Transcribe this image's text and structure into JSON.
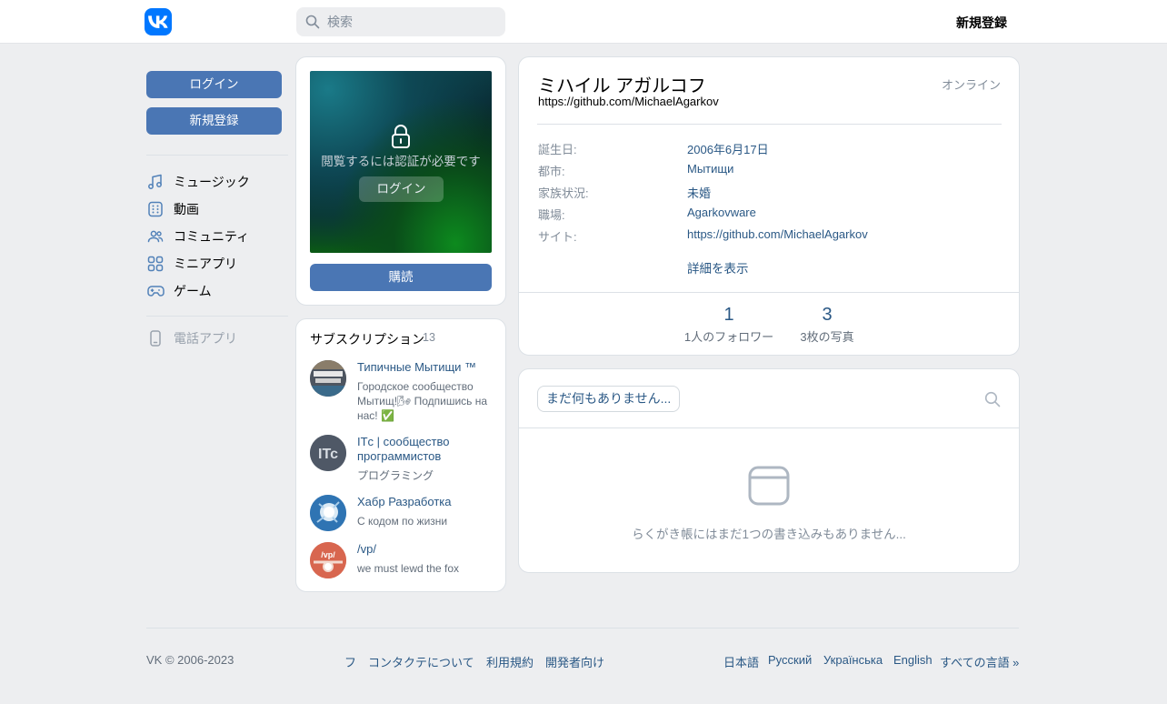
{
  "header": {
    "search_placeholder": "検索",
    "signup": "新規登録"
  },
  "sidebar": {
    "login": "ログイン",
    "signup": "新規登録",
    "items": [
      {
        "label": "ミュージック",
        "icon": "music-icon"
      },
      {
        "label": "動画",
        "icon": "video-icon"
      },
      {
        "label": "コミュニティ",
        "icon": "community-icon"
      },
      {
        "label": "ミニアプリ",
        "icon": "mini-apps-icon"
      },
      {
        "label": "ゲーム",
        "icon": "gamepad-icon"
      }
    ],
    "phone_app": "電話アプリ"
  },
  "photo_card": {
    "lock_text": "閲覧するには認証が必要です",
    "login": "ログイン",
    "subscribe": "購読"
  },
  "subscriptions": {
    "title": "サブスクリプション",
    "count": "13",
    "items": [
      {
        "name": "Типичные Мытищи ™",
        "desc": "Городское сообщество Мытищ!🌬 Подпишись на нас! ✅"
      },
      {
        "name": "ITс | сообщество программистов",
        "desc": "プログラミング"
      },
      {
        "name": "Хабр Разработка",
        "desc": "С кодом по жизни"
      },
      {
        "name": "/vp/",
        "desc": "we must lewd the fox"
      }
    ]
  },
  "profile": {
    "name": "ミハイル アガルコフ",
    "status": "https://github.com/MichaelAgarkov",
    "online": "オンライン",
    "info": [
      {
        "key": "誕生日:",
        "value": "2006年6月17日"
      },
      {
        "key": "都市:",
        "value": "Мытищи"
      },
      {
        "key": "家族状況:",
        "value": "未婚"
      },
      {
        "key": "職場:",
        "value": "Agarkovware"
      },
      {
        "key": "サイト:",
        "value": "https://github.com/MichaelAgarkov"
      }
    ],
    "more": "詳細を表示",
    "counters": [
      {
        "number": "1",
        "label": "1人のフォロワー"
      },
      {
        "number": "3",
        "label": "3枚の写真"
      }
    ]
  },
  "wall": {
    "tab": "まだ何もありません...",
    "empty_text": "らくがき帳にはまだ1つの書き込みもありません..."
  },
  "footer": {
    "copyright": "VK © 2006-2023",
    "links": [
      "フ",
      "コンタクテについて",
      "利用規約",
      "開発者向け"
    ],
    "languages": [
      "日本語",
      "Русский",
      "Українська",
      "English",
      "すべての言語 »"
    ]
  },
  "colors": {
    "brand": "#0077ff",
    "button": "#4a76b4",
    "link": "#2a5885",
    "background": "#edeef0"
  }
}
